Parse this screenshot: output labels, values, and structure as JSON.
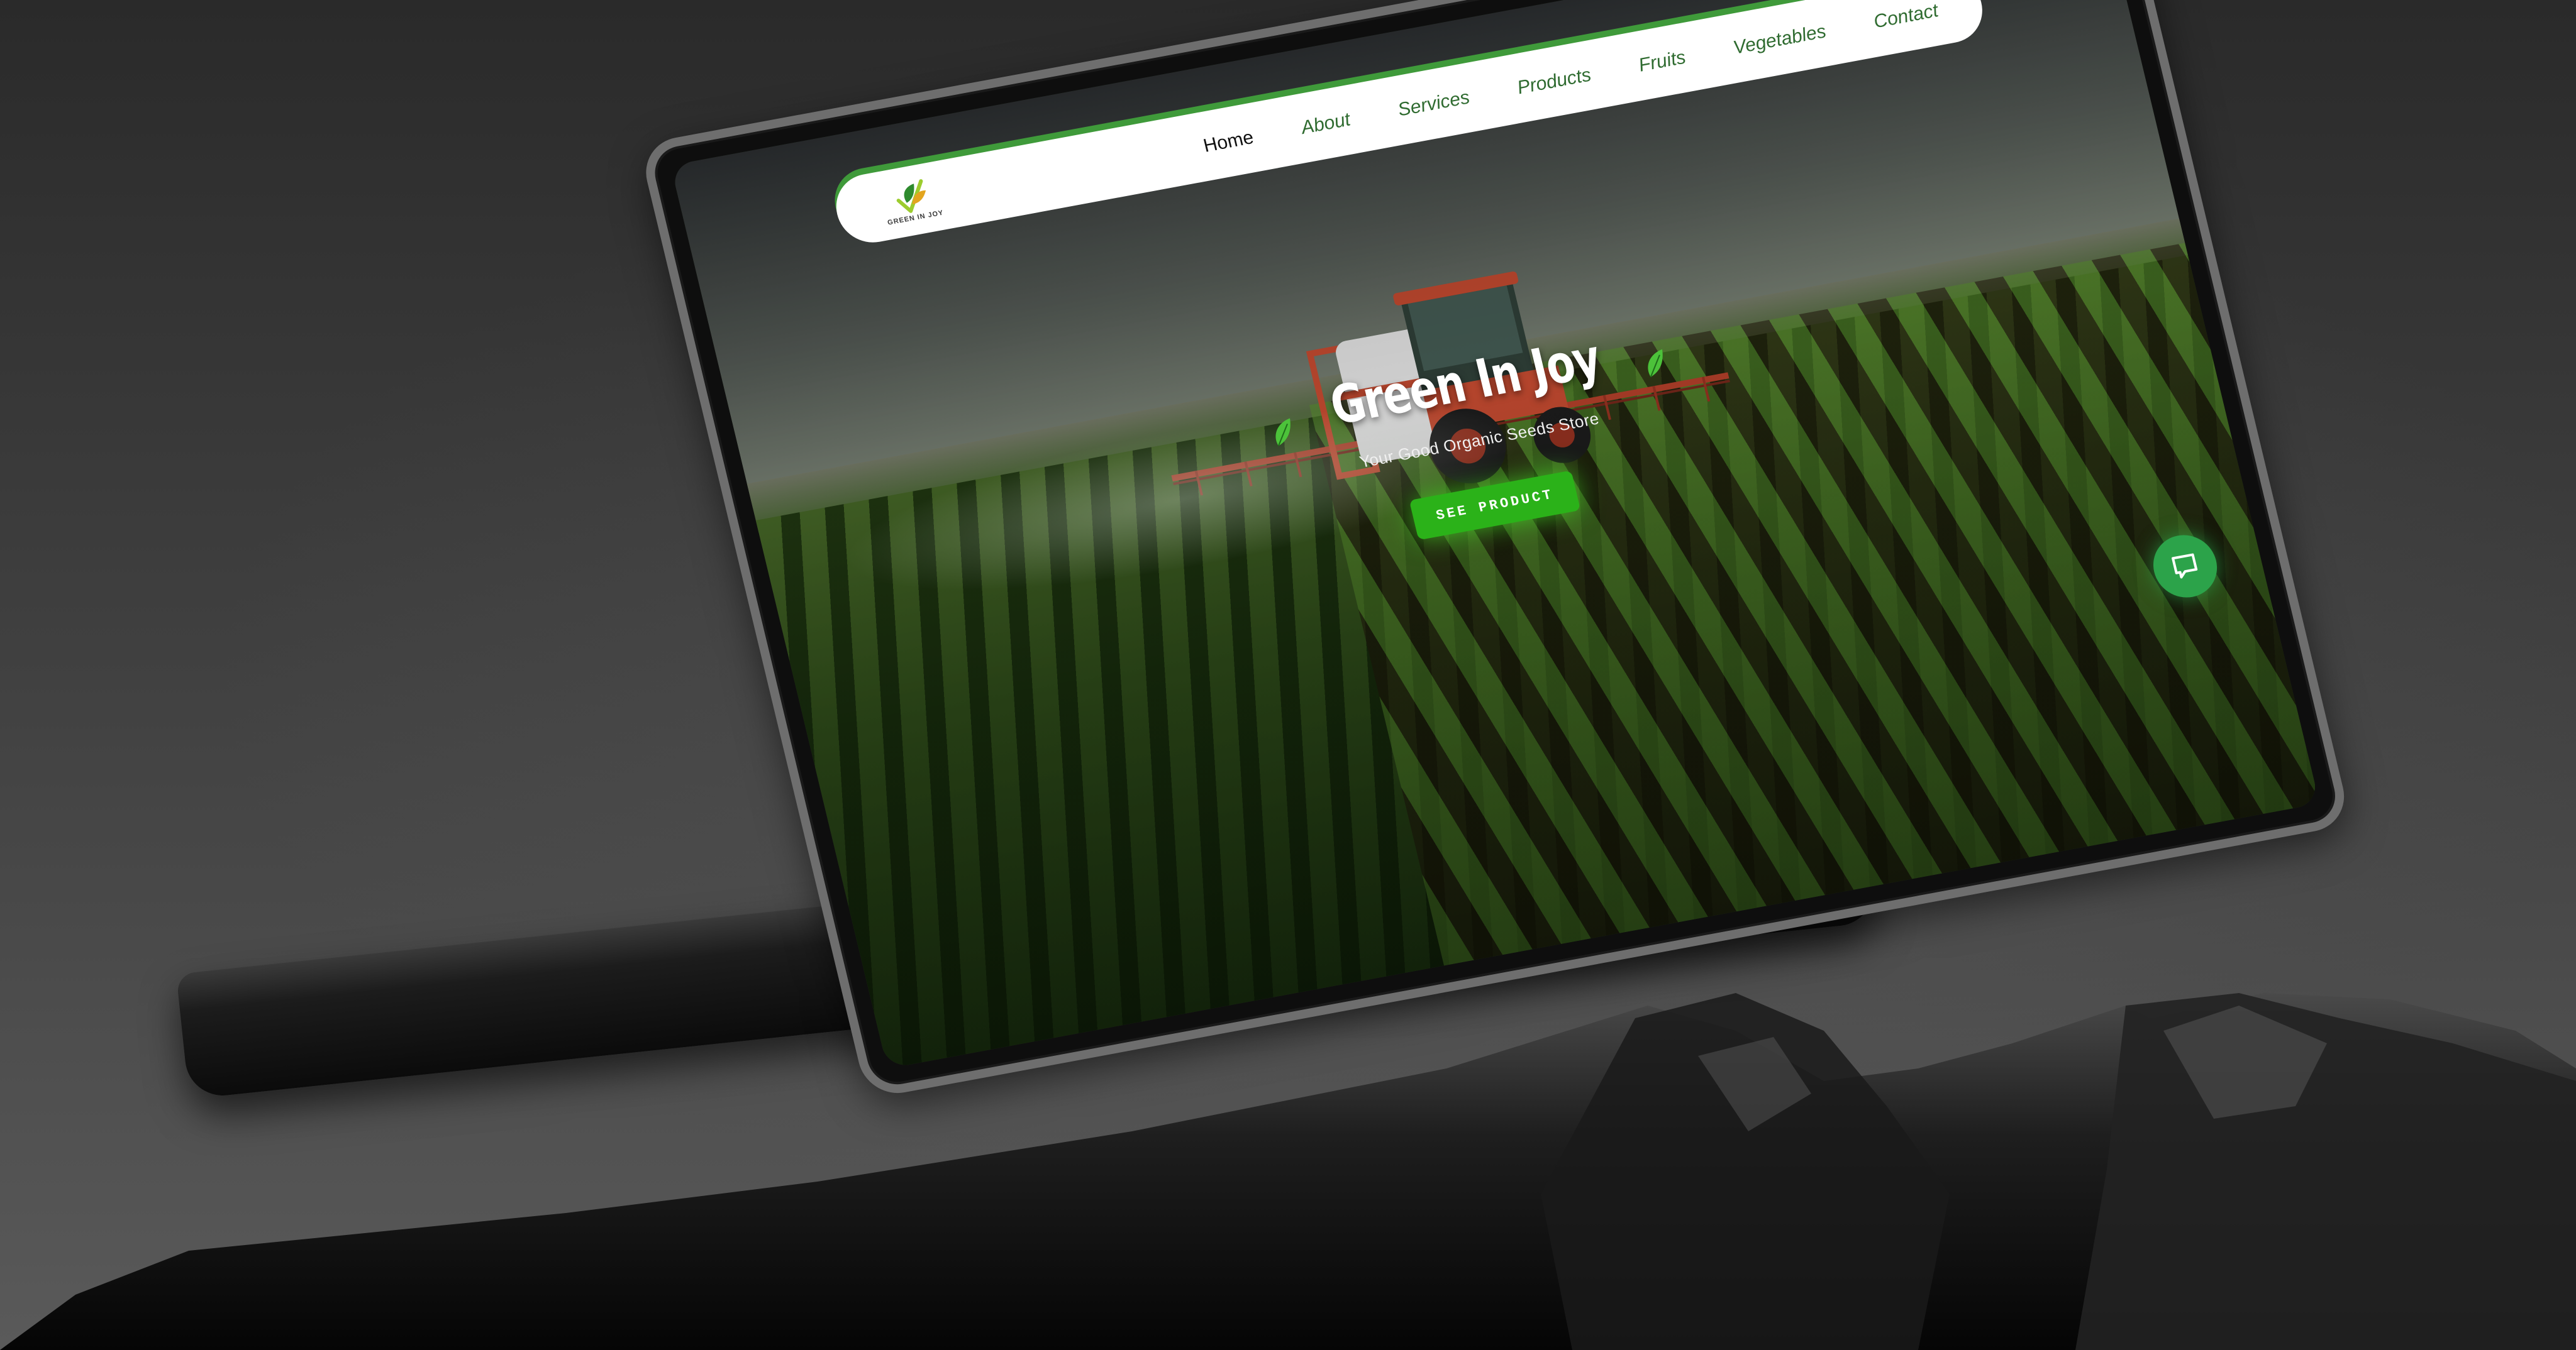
{
  "site": {
    "logo_text": "GREEN IN JOY",
    "nav": [
      {
        "label": "Home",
        "active": true
      },
      {
        "label": "About"
      },
      {
        "label": "Services"
      },
      {
        "label": "Products"
      },
      {
        "label": "Fruits"
      },
      {
        "label": "Vegetables"
      },
      {
        "label": "Contact"
      }
    ],
    "hero": {
      "title": "Green In Joy",
      "subtitle": "Your Good Organic Seeds Store",
      "cta_label": "SEE PRODUCT"
    },
    "chat_button_icon": "chat-bubble-icon"
  },
  "colors": {
    "brand_green": "#2bb219",
    "nav_accent": "#3f9a3a",
    "nav_text": "#2f6b30",
    "chat_green": "#2ca34a"
  },
  "icons": [
    "leaf-icon",
    "chat-bubble-icon",
    "logo-leaf-icon"
  ]
}
